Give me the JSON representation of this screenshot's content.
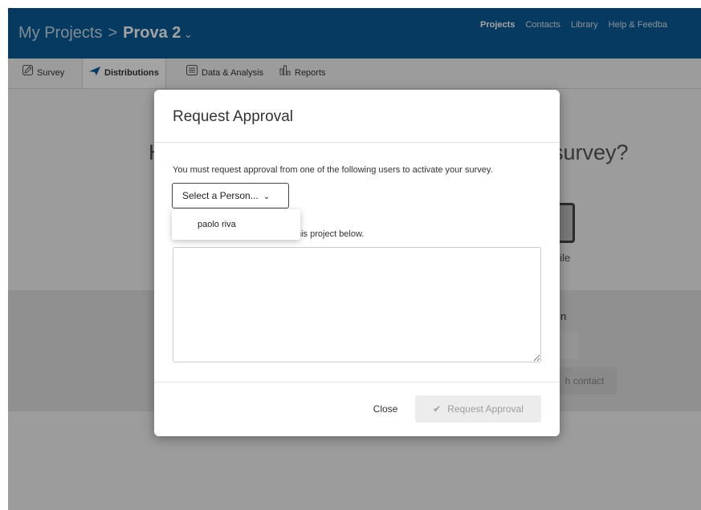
{
  "header": {
    "breadcrumb_root": "My Projects",
    "breadcrumb_sep": ">",
    "project_name": "Prova 2",
    "nav": [
      "Projects",
      "Contacts",
      "Library",
      "Help & Feedba"
    ]
  },
  "tabs": [
    {
      "label": "Survey",
      "icon": "pencil-icon"
    },
    {
      "label": "Distributions",
      "icon": "paper-plane-icon"
    },
    {
      "label": "Data & Analysis",
      "icon": "table-icon"
    },
    {
      "label": "Reports",
      "icon": "bar-chart-icon"
    }
  ],
  "background": {
    "heading_left": "H",
    "heading_right": "survey?",
    "mobile_fragment": "bile",
    "section_fragment": "n",
    "contact_fragment": "h contact"
  },
  "modal": {
    "title": "Request Approval",
    "description": "You must request approval from one of the following users to activate your survey.",
    "select_label": "Select a Person...",
    "partial_text": "his project below.",
    "message_value": "",
    "close_label": "Close",
    "request_label": "Request Approval"
  },
  "dropdown": {
    "options": [
      "paolo riva"
    ]
  },
  "colors": {
    "header_bg": "#0b5c96",
    "overlay": "rgba(0,0,0,0.36)",
    "disabled_button_bg": "#ececec"
  }
}
